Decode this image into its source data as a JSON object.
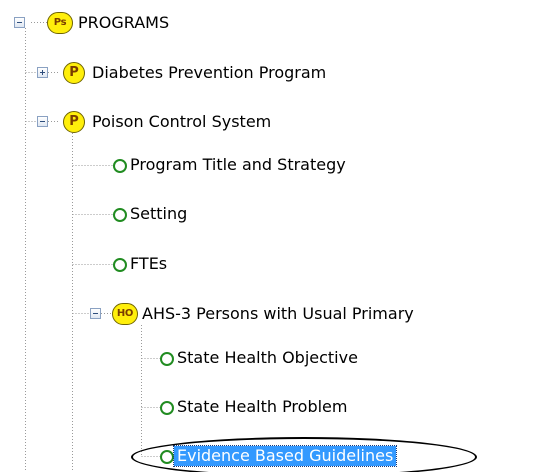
{
  "tree": {
    "root": {
      "badge": "Ps",
      "label": "PROGRAMS",
      "expanded": true,
      "children": [
        {
          "badge": "P",
          "label": "Diabetes Prevention Program",
          "expanded": false
        },
        {
          "badge": "P",
          "label": "Poison Control System",
          "expanded": true,
          "children": [
            {
              "node_icon": "green-circle-icon",
              "label": "Program Title and Strategy"
            },
            {
              "node_icon": "green-circle-icon",
              "label": "Setting"
            },
            {
              "node_icon": "green-circle-icon",
              "label": "FTEs"
            },
            {
              "badge": "HO",
              "label": "AHS-3 Persons with Usual Primary",
              "expanded": true,
              "children": [
                {
                  "node_icon": "green-circle-icon",
                  "label": "State Health Objective"
                },
                {
                  "node_icon": "green-circle-icon",
                  "label": "State Health Problem"
                },
                {
                  "node_icon": "green-circle-icon",
                  "label": "Evidence Based Guidelines",
                  "selected": true
                }
              ]
            }
          ]
        }
      ]
    }
  },
  "colors": {
    "badge_fill": "#ffef0b",
    "badge_text": "#7a3d00",
    "node_circle": "#218c21",
    "selection": "#3399ff",
    "tree_lines": "#9a9a9a"
  }
}
